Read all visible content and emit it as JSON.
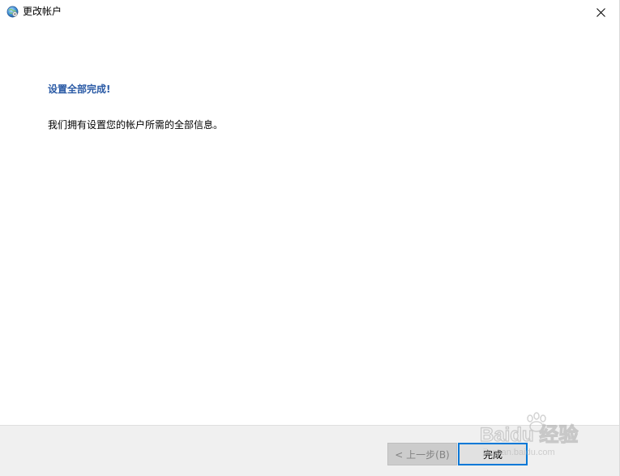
{
  "window": {
    "title": "更改帐户"
  },
  "main": {
    "heading": "设置全部完成!",
    "message": "我们拥有设置您的帐户所需的全部信息。"
  },
  "footer": {
    "back_label": "< 上一步(B)",
    "finish_label": "完成"
  },
  "watermark": {
    "text": "Baidu 经验",
    "url_text": "jingyan.baidu.com"
  },
  "colors": {
    "heading": "#2a5aa5",
    "accent_border": "#0078d7",
    "footer_bg": "#f0f0f0"
  },
  "icons": {
    "app": "globe-icon",
    "close": "close-icon"
  }
}
